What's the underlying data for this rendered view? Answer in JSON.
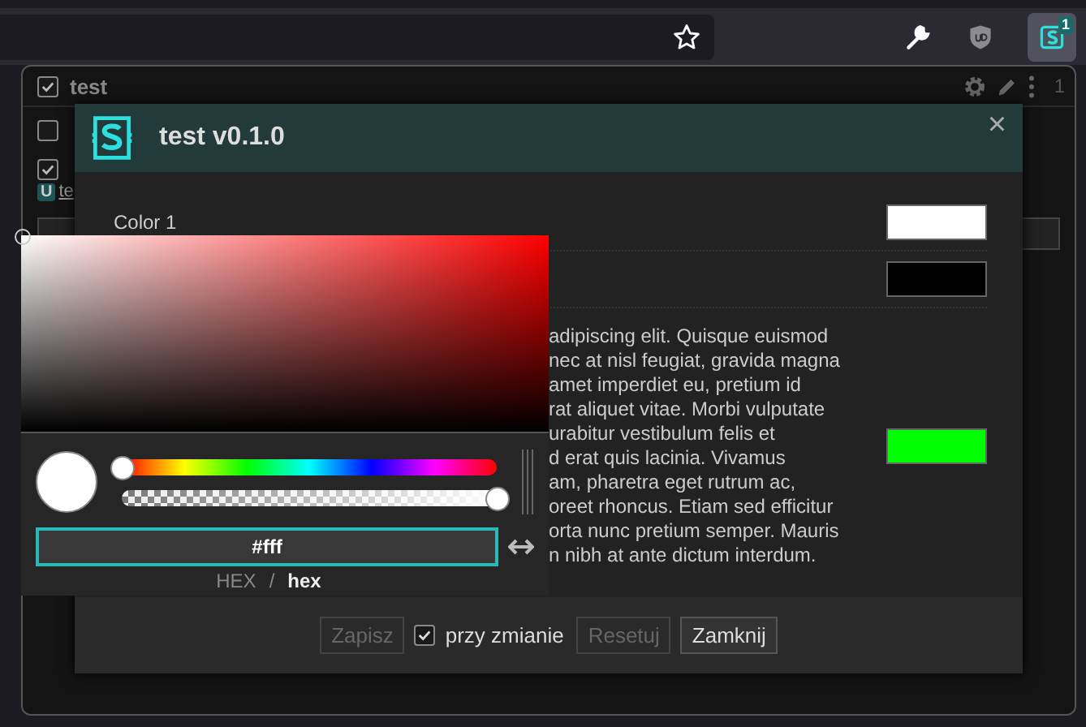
{
  "toolbar": {
    "extension_badge": "1",
    "extension_active": true
  },
  "panel": {
    "header": {
      "label": "test",
      "checked": true,
      "count": "1"
    },
    "items": [
      {
        "checked": false
      },
      {
        "checked": true
      }
    ],
    "badge": "U",
    "link": "te"
  },
  "dialog": {
    "title": "test v0.1.0",
    "close": "×",
    "settings": [
      {
        "kind": "color",
        "label": "Color 1",
        "color": "#ffffff"
      },
      {
        "kind": "color",
        "color": "#000000"
      },
      {
        "kind": "text",
        "lines": [
          "adipiscing elit. Quisque euismod",
          "nec at nisl feugiat, gravida magna",
          "amet imperdiet eu, pretium id",
          "rat aliquet vitae. Morbi vulputate",
          "urabitur vestibulum felis et",
          "d erat quis lacinia. Vivamus",
          "am, pharetra eget rutrum ac,",
          "oreet rhoncus. Etiam sed efficitur",
          "orta nunc pretium semper. Mauris",
          "n nibh at ante dictum interdum."
        ],
        "color": "#00ff00"
      }
    ],
    "footer": {
      "save": {
        "label": "Zapisz",
        "disabled": true
      },
      "on_change": {
        "label": "przy zmianie",
        "checked": true
      },
      "reset": {
        "label": "Resetuj",
        "disabled": true
      },
      "close": {
        "label": "Zamknij",
        "disabled": false
      }
    }
  },
  "picker": {
    "hue": {
      "level": 0
    },
    "alpha": {
      "level": 1
    },
    "value": "#fff",
    "separator": "/",
    "formats": [
      {
        "label": "HEX",
        "selected": false
      },
      {
        "label": "hex",
        "selected": true
      }
    ]
  }
}
